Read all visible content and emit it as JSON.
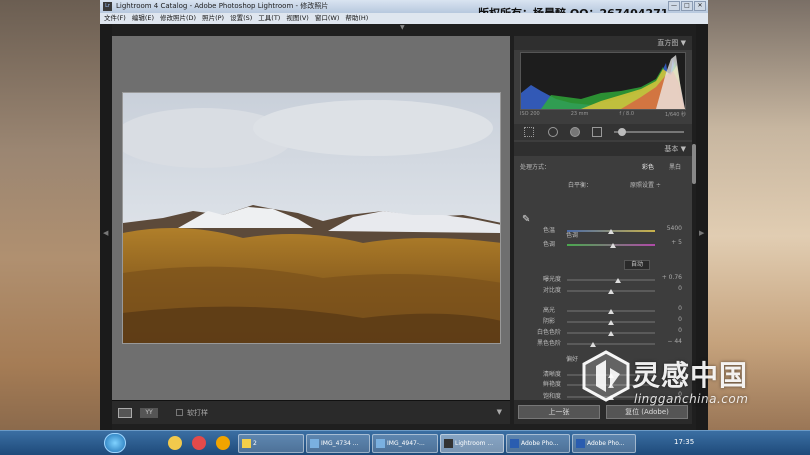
{
  "window": {
    "title": "Lightroom 4 Catalog - Adobe Photoshop Lightroom - 修改照片",
    "logo_text": "Lr",
    "watermark": "版权所有：杨晨醉   QQ：267404271",
    "controls": [
      "—",
      "□",
      "✕"
    ]
  },
  "menu": [
    "文件(F)",
    "编辑(E)",
    "修改照片(D)",
    "照片(P)",
    "设置(S)",
    "工具(T)",
    "视图(V)",
    "窗口(W)",
    "帮助(H)"
  ],
  "panel": {
    "histogram_title": "直方图 ▼",
    "hist_info": [
      "ISO 200",
      "23 mm",
      "f / 8.0",
      "1/640 秒"
    ],
    "basic_title": "基本 ▼",
    "treatment_label": "处理方式：",
    "treatment_color": "彩色",
    "treatment_bw": "黑白",
    "wb_label": "白平衡：",
    "wb_value": "原照设置 ÷",
    "tone_label": "色调",
    "auto_button": "自动",
    "presence_label": "偏好",
    "sliders": [
      {
        "label": "色温",
        "value": "5400",
        "pos": 0.5
      },
      {
        "label": "色调",
        "value": "+ 5",
        "pos": 0.52
      },
      {
        "label": "曝光度",
        "value": "+ 0.76",
        "pos": 0.58
      },
      {
        "label": "对比度",
        "value": "0",
        "pos": 0.5
      },
      {
        "label": "高光",
        "value": "0",
        "pos": 0.5
      },
      {
        "label": "阴影",
        "value": "0",
        "pos": 0.5
      },
      {
        "label": "白色色阶",
        "value": "0",
        "pos": 0.5
      },
      {
        "label": "黑色色阶",
        "value": "− 44",
        "pos": 0.3
      },
      {
        "label": "清晰度",
        "value": "0",
        "pos": 0.5
      },
      {
        "label": "鲜艳度",
        "value": "0",
        "pos": 0.5
      },
      {
        "label": "饱和度",
        "value": "0",
        "pos": 0.5
      }
    ],
    "prev_button": "上一张",
    "reset_button": "复位 (Adobe)"
  },
  "toolbar": {
    "soft_proof": "软打样",
    "view_yy": "YY"
  },
  "taskbar": {
    "items": [
      "2",
      "IMG_4734 ...",
      "IMG_4947-...",
      "Lightroom ...",
      "Adobe Pho...",
      "Adobe Pho..."
    ],
    "clock": "17:35"
  },
  "corner_logo": {
    "name": "灵感中国",
    "url": "lingganchina.com"
  },
  "colors": {
    "panel_bg": "#3d3d3d",
    "loupe_bg": "#6f6f6f",
    "taskbar": "#1e4a7a"
  }
}
